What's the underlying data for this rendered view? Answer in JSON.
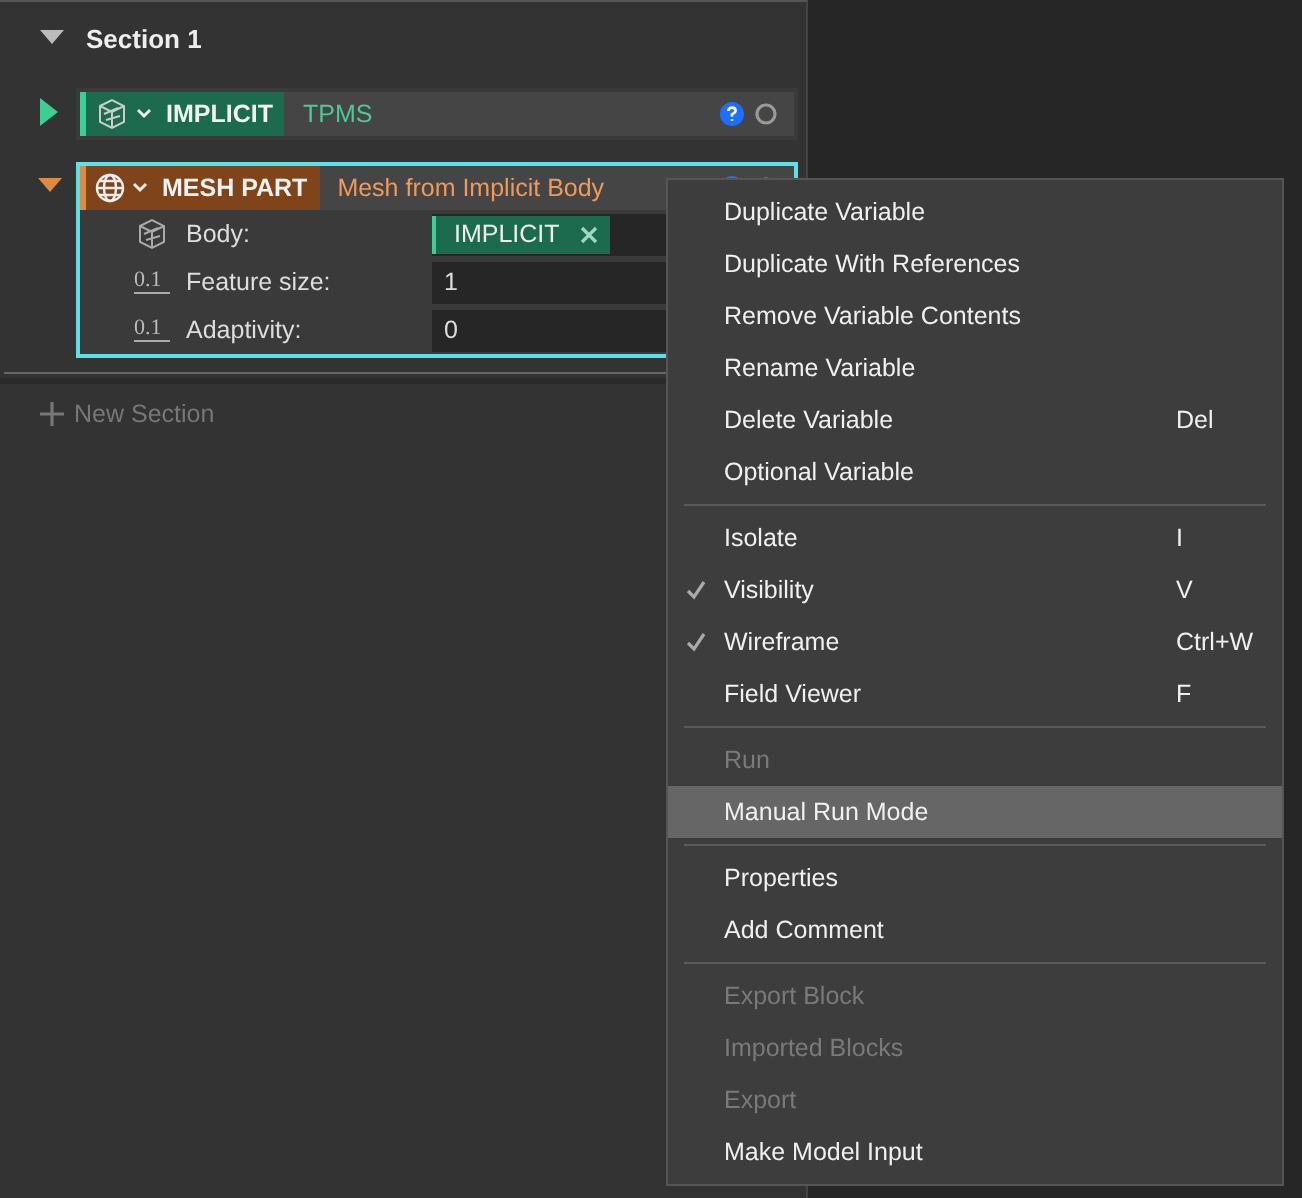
{
  "section": {
    "title": "Section 1",
    "expanded": true
  },
  "blocks": [
    {
      "kind": "implicit",
      "type_label": "IMPLICIT",
      "name": "TPMS",
      "expanded": false,
      "selected": false
    },
    {
      "kind": "mesh",
      "type_label": "MESH PART",
      "name": "Mesh from Implicit Body",
      "expanded": true,
      "selected": true,
      "params": [
        {
          "kind": "body",
          "label": "Body:",
          "value": "IMPLICIT"
        },
        {
          "kind": "number",
          "icon_text": "0.1",
          "label": "Feature size:",
          "value": "1"
        },
        {
          "kind": "number",
          "icon_text": "0.1",
          "label": "Adaptivity:",
          "value": "0"
        }
      ]
    }
  ],
  "new_section": "New Section",
  "menu": {
    "groups": [
      [
        {
          "label": "Duplicate Variable",
          "checked": false,
          "disabled": false,
          "selected": false
        },
        {
          "label": "Duplicate With References",
          "checked": false,
          "disabled": false,
          "selected": false
        },
        {
          "label": "Remove Variable Contents",
          "checked": false,
          "disabled": false,
          "selected": false
        },
        {
          "label": "Rename Variable",
          "checked": false,
          "disabled": false,
          "selected": false
        },
        {
          "label": "Delete Variable",
          "shortcut": "Del",
          "checked": false,
          "disabled": false,
          "selected": false
        },
        {
          "label": "Optional Variable",
          "checked": false,
          "disabled": false,
          "selected": false
        }
      ],
      [
        {
          "label": "Isolate",
          "shortcut": "I",
          "checked": false,
          "disabled": false,
          "selected": false
        },
        {
          "label": "Visibility",
          "shortcut": "V",
          "checked": true,
          "disabled": false,
          "selected": false
        },
        {
          "label": "Wireframe",
          "shortcut": "Ctrl+W",
          "checked": true,
          "disabled": false,
          "selected": false
        },
        {
          "label": "Field Viewer",
          "shortcut": "F",
          "checked": false,
          "disabled": false,
          "selected": false
        }
      ],
      [
        {
          "label": "Run",
          "checked": false,
          "disabled": true,
          "selected": false
        },
        {
          "label": "Manual Run Mode",
          "checked": false,
          "disabled": false,
          "selected": true
        }
      ],
      [
        {
          "label": "Properties",
          "checked": false,
          "disabled": false,
          "selected": false
        },
        {
          "label": "Add Comment",
          "checked": false,
          "disabled": false,
          "selected": false
        }
      ],
      [
        {
          "label": "Export Block",
          "checked": false,
          "disabled": true,
          "selected": false
        },
        {
          "label": "Imported Blocks",
          "checked": false,
          "disabled": true,
          "selected": false
        },
        {
          "label": "Export",
          "checked": false,
          "disabled": true,
          "selected": false
        },
        {
          "label": "Make Model Input",
          "checked": false,
          "disabled": false,
          "selected": false
        }
      ]
    ]
  }
}
